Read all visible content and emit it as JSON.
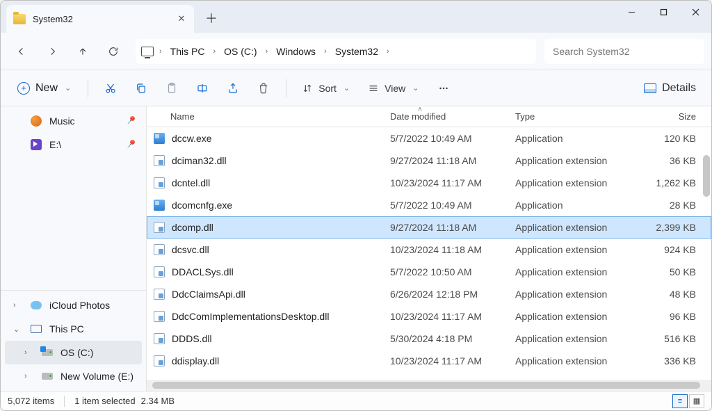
{
  "window": {
    "title": "System32"
  },
  "nav": {
    "crumbs": [
      "This PC",
      "OS (C:)",
      "Windows",
      "System32"
    ]
  },
  "search": {
    "placeholder": "Search System32"
  },
  "toolbar": {
    "new_label": "New",
    "sort_label": "Sort",
    "view_label": "View",
    "details_label": "Details"
  },
  "sidebar": {
    "quick": [
      {
        "label": "Music",
        "icon": "music"
      },
      {
        "label": "E:\\",
        "icon": "video"
      }
    ],
    "tree": [
      {
        "label": "iCloud Photos",
        "icon": "cloud",
        "chev": "›",
        "indent": 0
      },
      {
        "label": "This PC",
        "icon": "pc",
        "chev": "⌄",
        "indent": 0
      },
      {
        "label": "OS (C:)",
        "icon": "drive-win",
        "chev": "›",
        "indent": 1,
        "selected": true
      },
      {
        "label": "New Volume (E:)",
        "icon": "drive",
        "chev": "›",
        "indent": 1
      }
    ]
  },
  "columns": {
    "name": "Name",
    "date": "Date modified",
    "type": "Type",
    "size": "Size"
  },
  "files": [
    {
      "name": "dccw.exe",
      "date": "5/7/2022 10:49 AM",
      "type": "Application",
      "size": "120 KB",
      "ico": "exe"
    },
    {
      "name": "dciman32.dll",
      "date": "9/27/2024 11:18 AM",
      "type": "Application extension",
      "size": "36 KB",
      "ico": "dll"
    },
    {
      "name": "dcntel.dll",
      "date": "10/23/2024 11:17 AM",
      "type": "Application extension",
      "size": "1,262 KB",
      "ico": "dll"
    },
    {
      "name": "dcomcnfg.exe",
      "date": "5/7/2022 10:49 AM",
      "type": "Application",
      "size": "28 KB",
      "ico": "exe"
    },
    {
      "name": "dcomp.dll",
      "date": "9/27/2024 11:18 AM",
      "type": "Application extension",
      "size": "2,399 KB",
      "ico": "dll",
      "selected": true
    },
    {
      "name": "dcsvc.dll",
      "date": "10/23/2024 11:18 AM",
      "type": "Application extension",
      "size": "924 KB",
      "ico": "dll"
    },
    {
      "name": "DDACLSys.dll",
      "date": "5/7/2022 10:50 AM",
      "type": "Application extension",
      "size": "50 KB",
      "ico": "dll"
    },
    {
      "name": "DdcClaimsApi.dll",
      "date": "6/26/2024 12:18 PM",
      "type": "Application extension",
      "size": "48 KB",
      "ico": "dll"
    },
    {
      "name": "DdcComImplementationsDesktop.dll",
      "date": "10/23/2024 11:17 AM",
      "type": "Application extension",
      "size": "96 KB",
      "ico": "dll"
    },
    {
      "name": "DDDS.dll",
      "date": "5/30/2024 4:18 PM",
      "type": "Application extension",
      "size": "516 KB",
      "ico": "dll"
    },
    {
      "name": "ddisplay.dll",
      "date": "10/23/2024 11:17 AM",
      "type": "Application extension",
      "size": "336 KB",
      "ico": "dll"
    }
  ],
  "status": {
    "item_count": "5,072 items",
    "selection": "1 item selected",
    "sel_size": "2.34 MB"
  }
}
